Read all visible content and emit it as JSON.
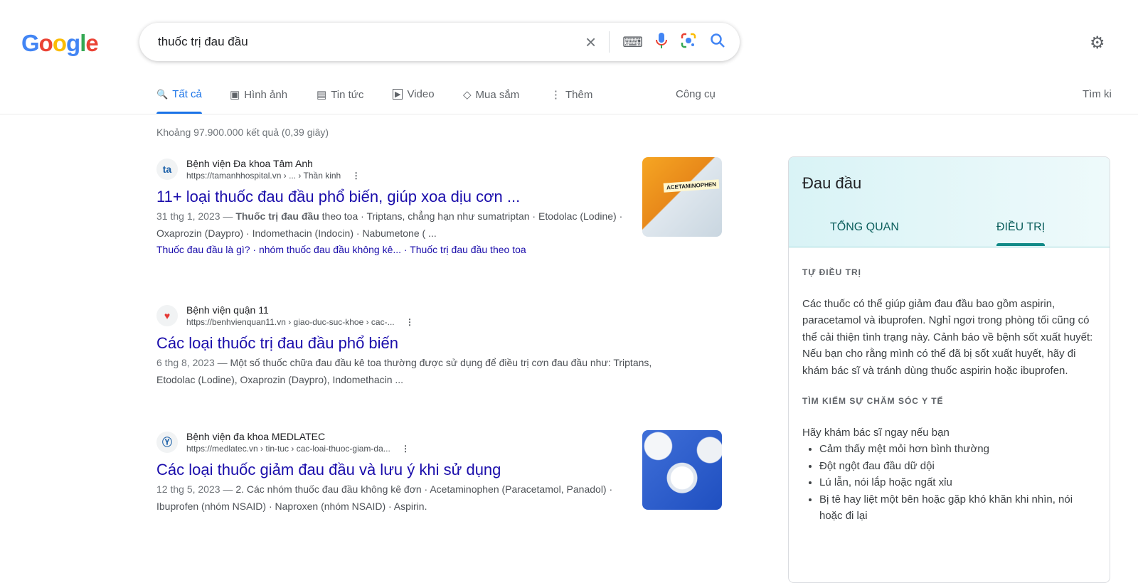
{
  "logo": [
    "G",
    "o",
    "o",
    "g",
    "l",
    "e"
  ],
  "search": {
    "query": "thuốc trị đau đầu"
  },
  "tabs": [
    {
      "label": "Tất cả",
      "icon": "🔍"
    },
    {
      "label": "Hình ảnh",
      "icon": "▣"
    },
    {
      "label": "Tin tức",
      "icon": "▤"
    },
    {
      "label": "Video",
      "icon": "▶"
    },
    {
      "label": "Mua sắm",
      "icon": "◇"
    },
    {
      "label": "Thêm",
      "icon": "⋮"
    }
  ],
  "tools": "Công cụ",
  "safe_search": "Tìm ki",
  "stats": "Khoảng 97.900.000 kết quả (0,39 giây)",
  "results": [
    {
      "favicon": "ta",
      "site": "Bệnh viện Đa khoa Tâm Anh",
      "url": "https://tamanhhospital.vn › ... › Thần kinh",
      "title": "11+ loại thuốc đau đầu phổ biến, giúp xoa dịu cơn ...",
      "date": "31 thg 1, 2023 —",
      "snippet_bold": "Thuốc trị đau đầu",
      "snippet": " theo toa · Triptans, chẳng hạn như sumatriptan · Etodolac (Lodine) · Oxaprozin (Daypro) · Indomethacin (Indocin) · Nabumetone ( ...",
      "links": "Thuốc đau đầu là gì? · nhóm thuốc đau đầu không kê... · Thuốc trị đau đầu theo toa",
      "thumb_label": "ACETAMINOPHEN"
    },
    {
      "favicon": "♥",
      "site": "Bệnh viện quận 11",
      "url": "https://benhvienquan11.vn › giao-duc-suc-khoe › cac-...",
      "title": "Các loại thuốc trị đau đầu phổ biến",
      "date": "6 thg 8, 2023 —",
      "snippet": "Một số thuốc chữa đau đầu kê toa thường được sử dụng để điều trị cơn đau đầu như: Triptans, Etodolac (Lodine), Oxaprozin (Daypro), Indomethacin ..."
    },
    {
      "favicon": "Ⓨ",
      "site": "Bệnh viện đa khoa MEDLATEC",
      "url": "https://medlatec.vn › tin-tuc › cac-loai-thuoc-giam-da...",
      "title": "Các loại thuốc giảm đau đầu và lưu ý khi sử dụng",
      "date": "12 thg 5, 2023 —",
      "snippet": "2. Các nhóm thuốc đau đầu không kê đơn · Acetaminophen (Paracetamol, Panadol) · Ibuprofen (nhóm NSAID) · Naproxen (nhóm NSAID) · Aspirin."
    }
  ],
  "knowledge": {
    "title": "Đau đầu",
    "tabs": [
      "TỔNG QUAN",
      "ĐIỀU TRỊ"
    ],
    "h1": "TỰ ĐIỀU TRỊ",
    "p1": "Các thuốc có thể giúp giảm đau đầu bao gồm aspirin, paracetamol và ibuprofen. Nghỉ ngơi trong phòng tối cũng có thể cải thiện tình trạng này. Cảnh báo về bệnh sốt xuất huyết: Nếu bạn cho rằng mình có thể đã bị sốt xuất huyết, hãy đi khám bác sĩ và tránh dùng thuốc aspirin hoặc ibuprofen.",
    "h2": "TÌM KIẾM SỰ CHĂM SÓC Y TẾ",
    "p2": "Hãy khám bác sĩ ngay nếu bạn",
    "items": [
      "Cảm thấy mệt mỏi hơn bình thường",
      "Đột ngột đau đầu dữ dội",
      "Lú lẫn, nói lắp hoặc ngất xỉu",
      "Bị tê hay liệt một bên hoặc gặp khó khăn khi nhìn, nói hoặc đi lại"
    ]
  }
}
